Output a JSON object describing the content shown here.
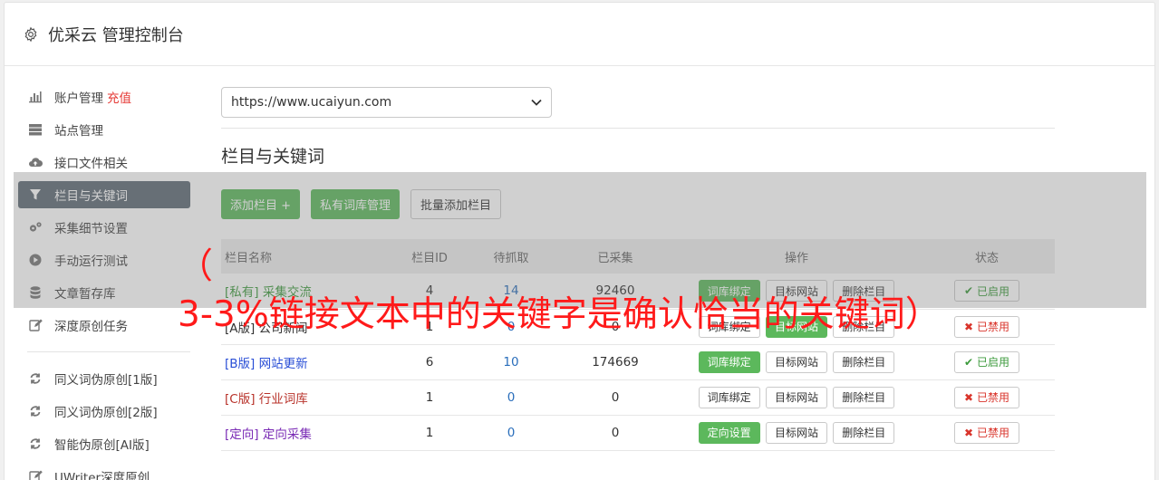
{
  "header": {
    "title": "优采云 管理控制台",
    "icon": "gear-icon"
  },
  "sidebar": {
    "items": [
      {
        "label": "账户管理",
        "extra": "充值",
        "icon": "bar-chart-icon"
      },
      {
        "label": "站点管理",
        "icon": "server-icon"
      },
      {
        "label": "接口文件相关",
        "icon": "cloud-upload-icon"
      },
      {
        "label": "栏目与关键词",
        "icon": "filter-icon"
      },
      {
        "label": "采集细节设置",
        "icon": "cogs-icon"
      },
      {
        "label": "手动运行测试",
        "icon": "play-icon"
      },
      {
        "label": "文章暂存库",
        "icon": "database-icon"
      },
      {
        "label": "深度原创任务",
        "icon": "edit-icon"
      },
      {
        "label": "同义词伪原创[1版]",
        "icon": "refresh-icon"
      },
      {
        "label": "同义词伪原创[2版]",
        "icon": "refresh-icon"
      },
      {
        "label": "智能伪原创[AI版]",
        "icon": "refresh-icon"
      },
      {
        "label": "UWriter深度原创",
        "icon": "edit-icon"
      }
    ]
  },
  "main": {
    "site_select": "https://www.ucaiyun.com",
    "section_title": "栏目与关键词",
    "toolbar": {
      "add_column": "添加栏目 +",
      "private_lib": "私有词库管理",
      "batch_add": "批量添加栏目"
    },
    "table": {
      "headers": [
        "栏目名称",
        "栏目ID",
        "待抓取",
        "已采集",
        "操作",
        "状态"
      ],
      "rows": [
        {
          "name": "[私有] 采集交流",
          "id": "4",
          "pending": "14",
          "collected": "92460",
          "op1": "词库绑定",
          "op2": "目标网站",
          "op3": "删除栏目",
          "status": "已启用"
        },
        {
          "name": "[A版] 公司新闻",
          "id": "1",
          "pending": "0",
          "collected": "0",
          "op1": "词库绑定",
          "op2": "目标网站",
          "op3": "删除栏目",
          "status": "已禁用"
        },
        {
          "name": "[B版] 网站更新",
          "id": "6",
          "pending": "10",
          "collected": "174669",
          "op1": "词库绑定",
          "op2": "目标网站",
          "op3": "删除栏目",
          "status": "已启用"
        },
        {
          "name": "[C版] 行业词库",
          "id": "1",
          "pending": "0",
          "collected": "0",
          "op1": "词库绑定",
          "op2": "目标网站",
          "op3": "删除栏目",
          "status": "已禁用"
        },
        {
          "name": "[定向] 定向采集",
          "id": "1",
          "pending": "0",
          "collected": "0",
          "op1": "定向设置",
          "op2": "目标网站",
          "op3": "删除栏目",
          "status": "已禁用"
        }
      ]
    }
  },
  "overlay": {
    "text": "（\n3-3%链接文本中的关键字是确认恰当的关键词）"
  },
  "colors": {
    "accent_green": "#5cb85c",
    "active_nav": "#5f6b76",
    "danger": "#d9342b",
    "overlay_text": "#ff1a1a"
  }
}
